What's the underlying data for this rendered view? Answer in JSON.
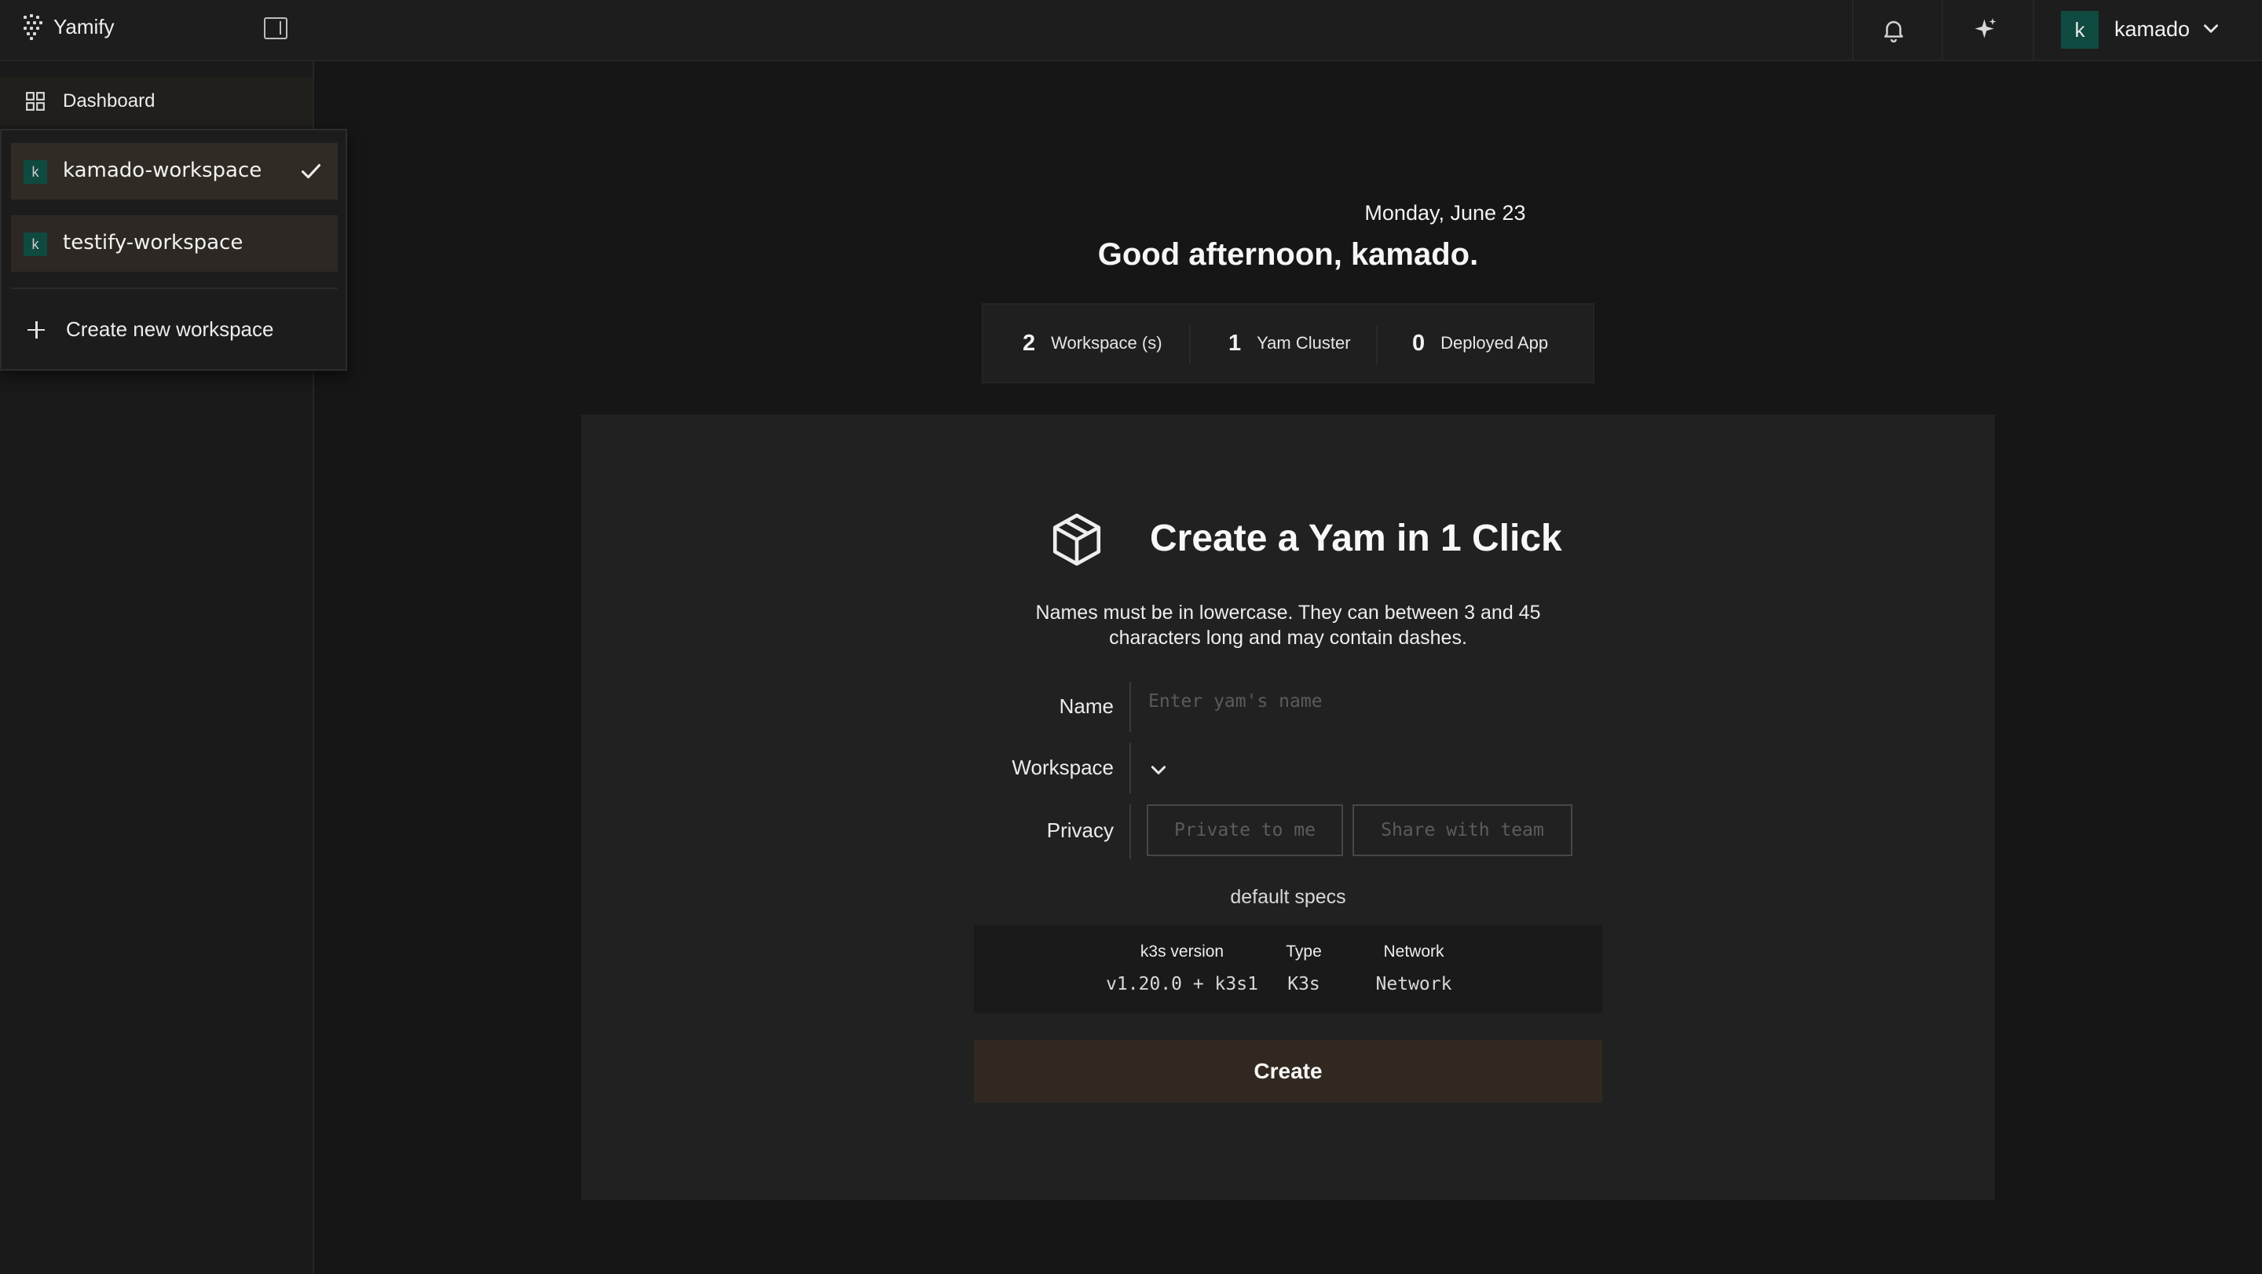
{
  "app": {
    "name": "Yamify"
  },
  "header": {
    "user_initial": "k",
    "user_name": "kamado"
  },
  "sidebar": {
    "items": [
      {
        "label": "Dashboard",
        "icon": "grid-icon"
      }
    ]
  },
  "workspace_menu": {
    "items": [
      {
        "initial": "k",
        "name": "kamado-workspace",
        "selected": true
      },
      {
        "initial": "k",
        "name": "testify-workspace",
        "selected": false
      }
    ],
    "create_label": "Create new workspace"
  },
  "main": {
    "date": "Monday, June 23",
    "greeting": "Good afternoon, kamado.",
    "stats": [
      {
        "value": "2",
        "label": "Workspace (s)"
      },
      {
        "value": "1",
        "label": "Yam Cluster"
      },
      {
        "value": "0",
        "label": "Deployed App"
      }
    ]
  },
  "create_card": {
    "title": "Create a Yam in 1 Click",
    "description": "Names must be in lowercase. They can between 3 and 45 characters long and may contain dashes.",
    "name_label": "Name",
    "name_placeholder": "Enter yam's name",
    "name_value": "",
    "workspace_label": "Workspace",
    "workspace_value": "",
    "privacy_label": "Privacy",
    "privacy_options": [
      "Private to me",
      "Share with team"
    ],
    "specs_title": "default specs",
    "specs": {
      "headers": [
        "k3s version",
        "Type",
        "Network"
      ],
      "values": [
        "v1.20.0 + k3s1",
        "K3s",
        "Network"
      ]
    },
    "create_label": "Create"
  },
  "colors": {
    "background": "#161616",
    "accent_avatar": "#0f4a40",
    "create_button": "#312921"
  }
}
